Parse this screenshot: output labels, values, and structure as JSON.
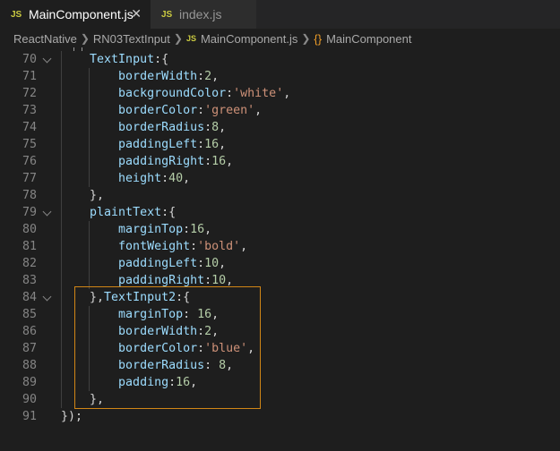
{
  "tabs": [
    {
      "icon": "JS",
      "label": "MainComponent.js",
      "close": "✕"
    },
    {
      "icon": "JS",
      "label": "index.js"
    }
  ],
  "breadcrumb": {
    "items": [
      "ReactNative",
      "RN03TextInput",
      "MainComponent.js",
      "MainComponent"
    ],
    "js_icon": "JS",
    "symbol_icon": "{}"
  },
  "lines": [
    {
      "num": "70",
      "fold": true,
      "tokens": [
        [
          "p",
          "    "
        ],
        [
          "k",
          "TextInput"
        ],
        [
          "p",
          ":{"
        ]
      ]
    },
    {
      "num": "71",
      "tokens": [
        [
          "p",
          "        "
        ],
        [
          "k",
          "borderWidth"
        ],
        [
          "p",
          ":"
        ],
        [
          "n",
          "2"
        ],
        [
          "p",
          ","
        ]
      ]
    },
    {
      "num": "72",
      "tokens": [
        [
          "p",
          "        "
        ],
        [
          "k",
          "backgroundColor"
        ],
        [
          "p",
          ":"
        ],
        [
          "s",
          "'white'"
        ],
        [
          "p",
          ","
        ]
      ]
    },
    {
      "num": "73",
      "tokens": [
        [
          "p",
          "        "
        ],
        [
          "k",
          "borderColor"
        ],
        [
          "p",
          ":"
        ],
        [
          "s",
          "'green'"
        ],
        [
          "p",
          ","
        ]
      ]
    },
    {
      "num": "74",
      "tokens": [
        [
          "p",
          "        "
        ],
        [
          "k",
          "borderRadius"
        ],
        [
          "p",
          ":"
        ],
        [
          "n",
          "8"
        ],
        [
          "p",
          ","
        ]
      ]
    },
    {
      "num": "75",
      "tokens": [
        [
          "p",
          "        "
        ],
        [
          "k",
          "paddingLeft"
        ],
        [
          "p",
          ":"
        ],
        [
          "n",
          "16"
        ],
        [
          "p",
          ","
        ]
      ]
    },
    {
      "num": "76",
      "tokens": [
        [
          "p",
          "        "
        ],
        [
          "k",
          "paddingRight"
        ],
        [
          "p",
          ":"
        ],
        [
          "n",
          "16"
        ],
        [
          "p",
          ","
        ]
      ]
    },
    {
      "num": "77",
      "tokens": [
        [
          "p",
          "        "
        ],
        [
          "k",
          "height"
        ],
        [
          "p",
          ":"
        ],
        [
          "n",
          "40"
        ],
        [
          "p",
          ","
        ]
      ]
    },
    {
      "num": "78",
      "tokens": [
        [
          "p",
          "    },"
        ]
      ]
    },
    {
      "num": "79",
      "fold": true,
      "tokens": [
        [
          "p",
          "    "
        ],
        [
          "k",
          "plaintText"
        ],
        [
          "p",
          ":{"
        ]
      ]
    },
    {
      "num": "80",
      "tokens": [
        [
          "p",
          "        "
        ],
        [
          "k",
          "marginTop"
        ],
        [
          "p",
          ":"
        ],
        [
          "n",
          "16"
        ],
        [
          "p",
          ","
        ]
      ]
    },
    {
      "num": "81",
      "tokens": [
        [
          "p",
          "        "
        ],
        [
          "k",
          "fontWeight"
        ],
        [
          "p",
          ":"
        ],
        [
          "s",
          "'bold'"
        ],
        [
          "p",
          ","
        ]
      ]
    },
    {
      "num": "82",
      "tokens": [
        [
          "p",
          "        "
        ],
        [
          "k",
          "paddingLeft"
        ],
        [
          "p",
          ":"
        ],
        [
          "n",
          "10"
        ],
        [
          "p",
          ","
        ]
      ]
    },
    {
      "num": "83",
      "tokens": [
        [
          "p",
          "        "
        ],
        [
          "k",
          "paddingRight"
        ],
        [
          "p",
          ":"
        ],
        [
          "n",
          "10"
        ],
        [
          "p",
          ","
        ]
      ]
    },
    {
      "num": "84",
      "fold": true,
      "tokens": [
        [
          "p",
          "    },"
        ],
        [
          "k",
          "TextInput2"
        ],
        [
          "p",
          ":{"
        ]
      ]
    },
    {
      "num": "85",
      "tokens": [
        [
          "p",
          "        "
        ],
        [
          "k",
          "marginTop"
        ],
        [
          "p",
          ": "
        ],
        [
          "n",
          "16"
        ],
        [
          "p",
          ","
        ]
      ]
    },
    {
      "num": "86",
      "tokens": [
        [
          "p",
          "        "
        ],
        [
          "k",
          "borderWidth"
        ],
        [
          "p",
          ":"
        ],
        [
          "n",
          "2"
        ],
        [
          "p",
          ","
        ]
      ]
    },
    {
      "num": "87",
      "tokens": [
        [
          "p",
          "        "
        ],
        [
          "k",
          "borderColor"
        ],
        [
          "p",
          ":"
        ],
        [
          "s",
          "'blue'"
        ],
        [
          "p",
          ","
        ]
      ]
    },
    {
      "num": "88",
      "tokens": [
        [
          "p",
          "        "
        ],
        [
          "k",
          "borderRadius"
        ],
        [
          "p",
          ": "
        ],
        [
          "n",
          "8"
        ],
        [
          "p",
          ","
        ]
      ]
    },
    {
      "num": "89",
      "tokens": [
        [
          "p",
          "        "
        ],
        [
          "k",
          "padding"
        ],
        [
          "p",
          ":"
        ],
        [
          "n",
          "16"
        ],
        [
          "p",
          ","
        ]
      ]
    },
    {
      "num": "90",
      "tokens": [
        [
          "p",
          "    },"
        ]
      ]
    },
    {
      "num": "91",
      "tokens": [
        [
          "p",
          "});"
        ]
      ]
    }
  ]
}
